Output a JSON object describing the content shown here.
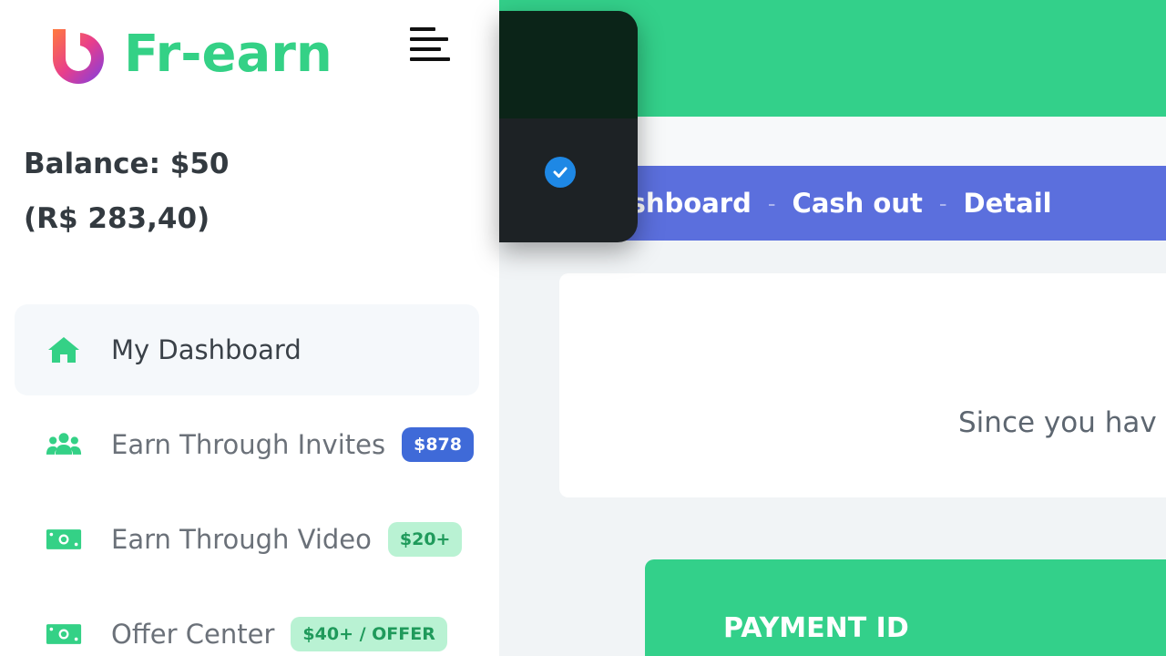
{
  "app": {
    "brand": "Fr-earn"
  },
  "balance": {
    "usd": "Balance: $50",
    "brl": "(R$ 283,40)"
  },
  "menu": [
    {
      "label": "My Dashboard",
      "icon": "home-icon",
      "active": true
    },
    {
      "label": "Earn Through Invites",
      "icon": "users-icon",
      "badge": "$878",
      "badge_color": "blue"
    },
    {
      "label": "Earn Through Video",
      "icon": "money-icon",
      "badge": "$20+",
      "badge_color": "green"
    },
    {
      "label": "Offer Center",
      "icon": "money-icon",
      "badge": "$40+ / OFFER",
      "badge_color": "green"
    }
  ],
  "breadcrumb": {
    "item1": "Dashboard",
    "item2": "Cash out",
    "item3": "Detail",
    "separator": "-"
  },
  "card": {
    "text": "Since you hav"
  },
  "table": {
    "header": "PAYMENT ID"
  },
  "colors": {
    "brand_green": "#34d186",
    "breadcrumb_blue": "#5b6fdd",
    "badge_blue": "#3f6ad8"
  }
}
